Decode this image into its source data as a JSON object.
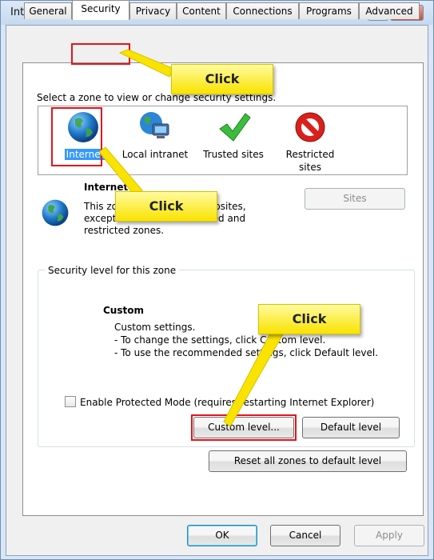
{
  "window": {
    "title": "Internet Options",
    "help_label": "?",
    "close_label": "×"
  },
  "tabs": [
    {
      "label": "General",
      "active": false
    },
    {
      "label": "Security",
      "active": true
    },
    {
      "label": "Privacy",
      "active": false
    },
    {
      "label": "Content",
      "active": false
    },
    {
      "label": "Connections",
      "active": false
    },
    {
      "label": "Programs",
      "active": false
    },
    {
      "label": "Advanced",
      "active": false
    }
  ],
  "zones": {
    "prompt": "Select a zone to view or change security settings.",
    "items": [
      {
        "label": "Internet",
        "icon": "globe-icon",
        "selected": true
      },
      {
        "label": "Local intranet",
        "icon": "intranet-icon",
        "selected": false
      },
      {
        "label": "Trusted sites",
        "icon": "checkmark-icon",
        "selected": false
      },
      {
        "label": "Restricted sites",
        "icon": "restricted-icon",
        "selected": false
      }
    ]
  },
  "zone_info": {
    "title": "Internet",
    "description": "This zone is for Internet websites, except those listed in trusted and restricted zones.",
    "sites_button": "Sites"
  },
  "security_level": {
    "group_label": "Security level for this zone",
    "level_title": "Custom",
    "desc_line1": "Custom settings.",
    "desc_line2": "- To change the settings, click Custom level.",
    "desc_line3": "- To use the recommended settings, click Default level.",
    "protected_mode_label": "Enable Protected Mode (requires restarting Internet Explorer)",
    "protected_mode_checked": false,
    "custom_level_button": "Custom level...",
    "default_level_button": "Default level",
    "reset_button": "Reset all zones to default level"
  },
  "footer": {
    "ok": "OK",
    "cancel": "Cancel",
    "apply": "Apply"
  },
  "annotations": {
    "callout_1": "Click",
    "callout_2": "Click",
    "callout_3": "Click",
    "highlight_color": "#e3141b",
    "callout_color": "#f9e300"
  }
}
